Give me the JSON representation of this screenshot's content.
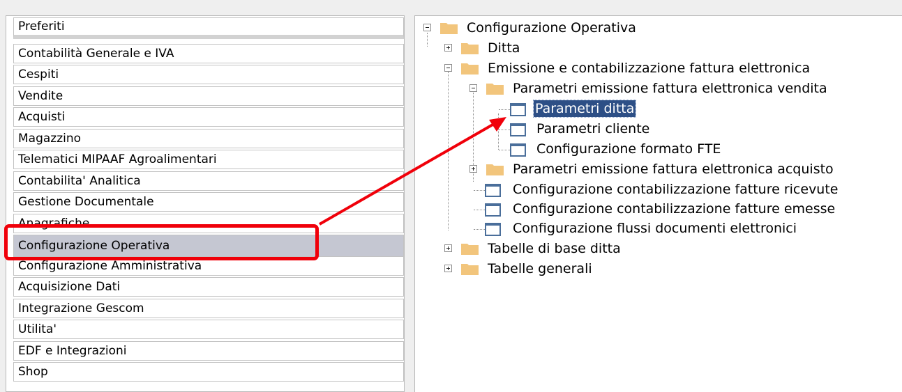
{
  "menu": {
    "items": [
      {
        "label": "Preferiti"
      },
      {
        "label": "Contabilità Generale e IVA"
      },
      {
        "label": "Cespiti"
      },
      {
        "label": "Vendite"
      },
      {
        "label": "Acquisti"
      },
      {
        "label": "Magazzino"
      },
      {
        "label": "Telematici MIPAAF Agroalimentari"
      },
      {
        "label": "Contabilita' Analitica"
      },
      {
        "label": "Gestione Documentale"
      },
      {
        "label": "Anagrafiche"
      },
      {
        "label": "Configurazione Operativa"
      },
      {
        "label": "Configurazione Amministrativa"
      },
      {
        "label": "Acquisizione Dati"
      },
      {
        "label": "Integrazione Gescom"
      },
      {
        "label": "Utilita'"
      },
      {
        "label": "EDF e Integrazioni"
      },
      {
        "label": "Shop"
      }
    ],
    "selected": "Configurazione Operativa"
  },
  "tree": {
    "nodes": [
      {
        "label": "Configurazione Operativa",
        "icon": "folder-icon",
        "state": "expanded"
      },
      {
        "label": "Ditta",
        "icon": "folder-icon",
        "state": "collapsed"
      },
      {
        "label": "Emissione e contabilizzazione fattura elettronica",
        "icon": "folder-icon",
        "state": "expanded"
      },
      {
        "label": "Parametri emissione fattura elettronica vendita",
        "icon": "folder-icon",
        "state": "expanded"
      },
      {
        "label": "Parametri ditta",
        "icon": "document-icon",
        "state": "selected"
      },
      {
        "label": "Parametri cliente",
        "icon": "document-icon"
      },
      {
        "label": "Configurazione formato FTE",
        "icon": "document-icon"
      },
      {
        "label": "Parametri emissione fattura elettronica acquisto",
        "icon": "folder-icon",
        "state": "collapsed"
      },
      {
        "label": "Configurazione contabilizzazione fatture ricevute",
        "icon": "document-icon"
      },
      {
        "label": "Configurazione contabilizzazione fatture emesse",
        "icon": "document-icon"
      },
      {
        "label": "Configurazione flussi documenti elettronici",
        "icon": "document-icon"
      },
      {
        "label": "Tabelle di base ditta",
        "icon": "folder-icon",
        "state": "collapsed"
      },
      {
        "label": "Tabelle generali",
        "icon": "folder-icon",
        "state": "collapsed"
      }
    ]
  },
  "annotation": {
    "highlight_color": "#f0000a",
    "selection_color": "#2d4f86",
    "folder_color": "#f2c57c"
  }
}
